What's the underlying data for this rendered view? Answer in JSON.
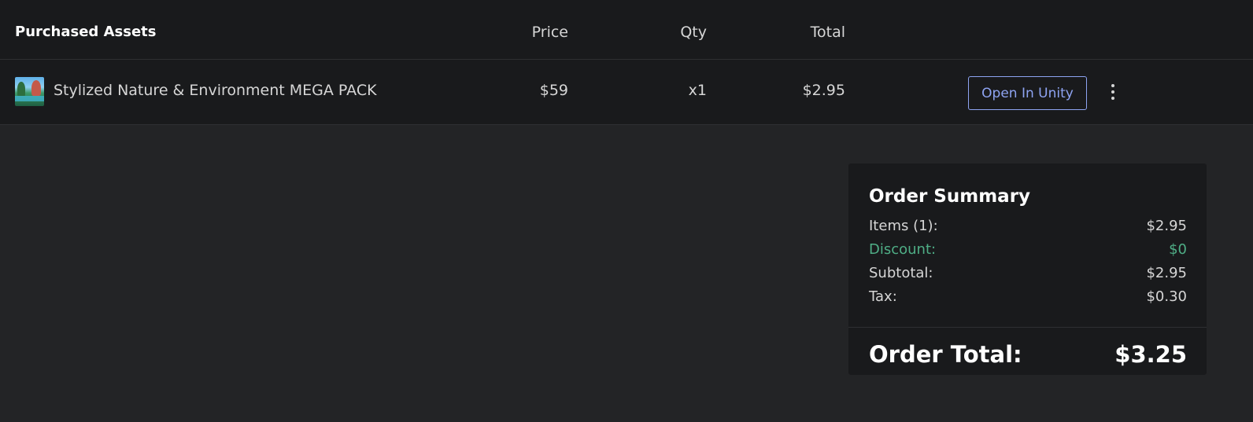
{
  "table": {
    "headers": {
      "title": "Purchased Assets",
      "price": "Price",
      "qty": "Qty",
      "total": "Total"
    },
    "rows": [
      {
        "name": "Stylized Nature & Environment MEGA PACK",
        "price": "$59",
        "qty": "x1",
        "total": "$2.95",
        "action_label": "Open In Unity",
        "thumbnail_icon": "nature-landscape-thumbnail"
      }
    ]
  },
  "summary": {
    "title": "Order Summary",
    "items_label": "Items (1):",
    "items_value": "$2.95",
    "discount_label": "Discount:",
    "discount_value": "$0",
    "subtotal_label": "Subtotal:",
    "subtotal_value": "$2.95",
    "tax_label": "Tax:",
    "tax_value": "$0.30",
    "total_label": "Order Total:",
    "total_value": "$3.25"
  },
  "colors": {
    "page_bg": "#232426",
    "panel_bg": "#191a1c",
    "accent": "#8ea4f2",
    "discount": "#4fae86"
  }
}
